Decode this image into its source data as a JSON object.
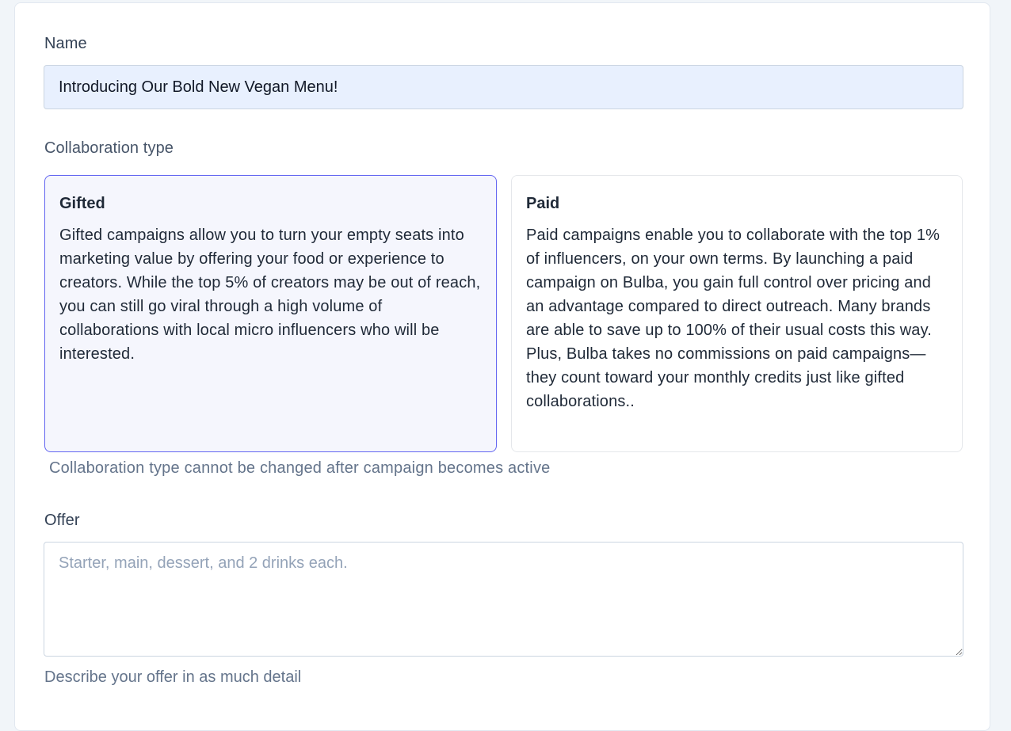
{
  "form": {
    "name": {
      "label": "Name",
      "value": "Introducing Our Bold New Vegan Menu!"
    },
    "collaboration_type": {
      "label": "Collaboration type",
      "selected": "Gifted",
      "options": [
        {
          "title": "Gifted",
          "description": "Gifted campaigns allow you to turn your empty seats into marketing value by offering your food or experience to creators. While the top 5% of creators may be out of reach, you can still go viral through a high volume of collaborations with local micro influencers who will be interested."
        },
        {
          "title": "Paid",
          "description": "Paid campaigns enable you to collaborate with the top 1% of influencers, on your own terms. By launching a paid campaign on Bulba, you gain full control over pricing and an advantage compared to direct outreach. Many brands are able to save up to 100% of their usual costs this way. Plus, Bulba takes no commissions on paid campaigns—they count toward your monthly credits just like gifted collaborations.."
        }
      ],
      "hint": "Collaboration type cannot be changed after campaign becomes active"
    },
    "offer": {
      "label": "Offer",
      "value": "",
      "placeholder": "Starter, main, dessert, and 2 drinks each.",
      "hint": "Describe your offer in as much detail"
    }
  },
  "colors": {
    "selected_border": "#6366f1",
    "selected_background": "#f5f6fd",
    "autofill_background": "#e8f0fe"
  }
}
